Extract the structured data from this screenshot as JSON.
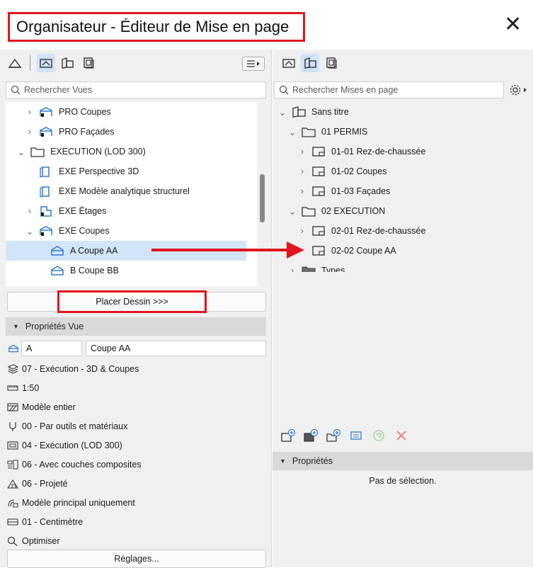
{
  "window": {
    "title": "Organisateur - Éditeur de Mise en page",
    "close_icon": "close-icon"
  },
  "left": {
    "search_placeholder": "Rechercher Vues",
    "tree": [
      {
        "label": "PRO Coupes",
        "icon": "section-view-icon",
        "chevron": "right"
      },
      {
        "label": "PRO Façades",
        "icon": "elevation-view-icon",
        "chevron": "right"
      },
      {
        "label": "EXECUTION (LOD 300)",
        "icon": "folder-icon",
        "chevron": "down"
      },
      {
        "label": "EXE Perspective 3D",
        "icon": "3d-view-icon",
        "chevron": ""
      },
      {
        "label": "EXE Modèle analytique structurel",
        "icon": "3d-view-icon",
        "chevron": ""
      },
      {
        "label": "EXE Étages",
        "icon": "floor-plan-icon",
        "chevron": "right"
      },
      {
        "label": "EXE Coupes",
        "icon": "section-view-icon",
        "chevron": "down"
      },
      {
        "label": "A Coupe AA",
        "icon": "section-icon",
        "chevron": "",
        "selected": true
      },
      {
        "label": "B Coupe BB",
        "icon": "section-icon",
        "chevron": ""
      }
    ],
    "place_button": "Placer Dessin >>>",
    "properties_header": "Propriétés Vue",
    "view_id": "A",
    "view_name": "Coupe AA",
    "properties": [
      {
        "label": "07 - Exécution - 3D & Coupes",
        "icon": "layer-combination-icon"
      },
      {
        "label": "1:50",
        "icon": "scale-icon"
      },
      {
        "label": "Modèle entier",
        "icon": "structure-display-icon"
      },
      {
        "label": "00 - Par outils et matériaux",
        "icon": "pen-set-icon"
      },
      {
        "label": "04 - Exécution (LOD 300)",
        "icon": "model-view-options-icon"
      },
      {
        "label": "06 - Avec couches composites",
        "icon": "partial-structure-icon"
      },
      {
        "label": "06 - Projeté",
        "icon": "renovation-filter-icon"
      },
      {
        "label": "Modèle principal uniquement",
        "icon": "graphic-override-icon"
      },
      {
        "label": "01 - Centimètre",
        "icon": "dimension-icon"
      },
      {
        "label": "Optimiser",
        "icon": "zoom-icon"
      }
    ],
    "settings_button": "Réglages..."
  },
  "right": {
    "search_placeholder": "Rechercher Mises en page",
    "tree": [
      {
        "label": "Sans titre",
        "icon": "layout-book-icon",
        "chevron": "down",
        "level": 0
      },
      {
        "label": "01 PERMIS",
        "icon": "folder-icon",
        "chevron": "down",
        "level": 1
      },
      {
        "label": "01-01 Rez-de-chaussée",
        "icon": "layout-icon",
        "chevron": "right",
        "level": 2
      },
      {
        "label": "01-02 Coupes",
        "icon": "layout-icon",
        "chevron": "right",
        "level": 2
      },
      {
        "label": "01-03 Façades",
        "icon": "layout-icon",
        "chevron": "right",
        "level": 2
      },
      {
        "label": "02 EXECUTION",
        "icon": "folder-icon",
        "chevron": "down",
        "level": 1
      },
      {
        "label": "02-01 Rez-de-chaussée",
        "icon": "layout-icon",
        "chevron": "right",
        "level": 2
      },
      {
        "label": "02-02 Coupe AA",
        "icon": "layout-icon",
        "chevron": "",
        "level": 2
      },
      {
        "label": "Types",
        "icon": "master-folder-icon",
        "chevron": "right",
        "level": 1
      }
    ],
    "properties_header": "Propriétés",
    "no_selection": "Pas de sélection."
  },
  "colors": {
    "annotation_red": "#e0151d",
    "selection": "#d3e5f8",
    "icon_blue": "#2f7ad1"
  }
}
